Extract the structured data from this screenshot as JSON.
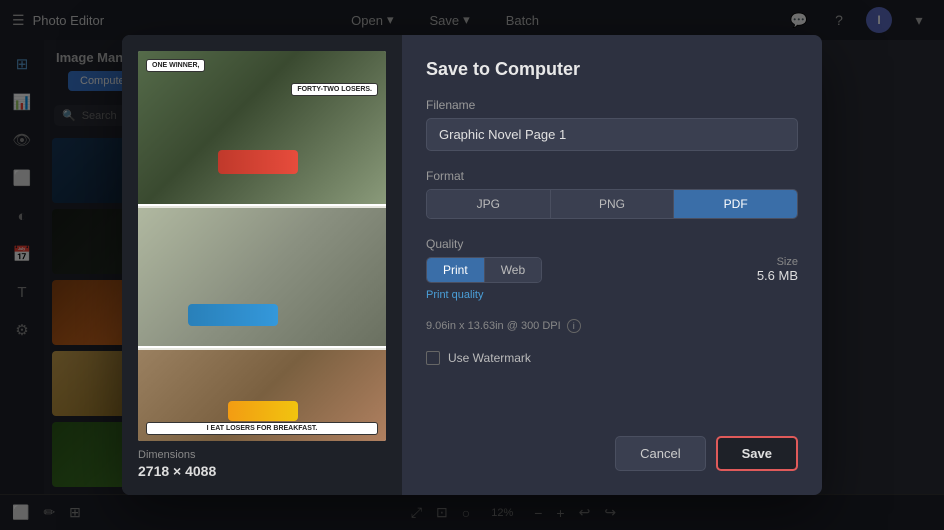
{
  "app": {
    "title": "Photo Editor"
  },
  "topbar": {
    "open_label": "Open",
    "save_label": "Save",
    "batch_label": "Batch"
  },
  "panel": {
    "title": "Image Manager",
    "tab_label": "Computer",
    "search_placeholder": "Search"
  },
  "dialog": {
    "title": "Save to Computer",
    "filename_label": "Filename",
    "filename_value": "Graphic Novel Page 1",
    "format_label": "Format",
    "formats": [
      "JPG",
      "PNG",
      "PDF"
    ],
    "active_format": "PDF",
    "quality_label": "Quality",
    "quality_options": [
      "Print",
      "Web"
    ],
    "active_quality": "Print",
    "print_quality_link": "Print quality",
    "size_label": "Size",
    "size_value": "5.6 MB",
    "dpi_info": "9.06in x 13.63in @ 300 DPI",
    "watermark_label": "Use Watermark",
    "cancel_label": "Cancel",
    "save_label": "Save",
    "dimensions_label": "Dimensions",
    "dimensions_value": "2718 × 4088"
  },
  "zoom": {
    "level": "12%"
  },
  "comic": {
    "bubble1": "ONE WINNER,",
    "bubble2": "FORTY-TWO LOSERS.",
    "bubble3": "I EAT LOSERS FOR BREAKFAST."
  }
}
